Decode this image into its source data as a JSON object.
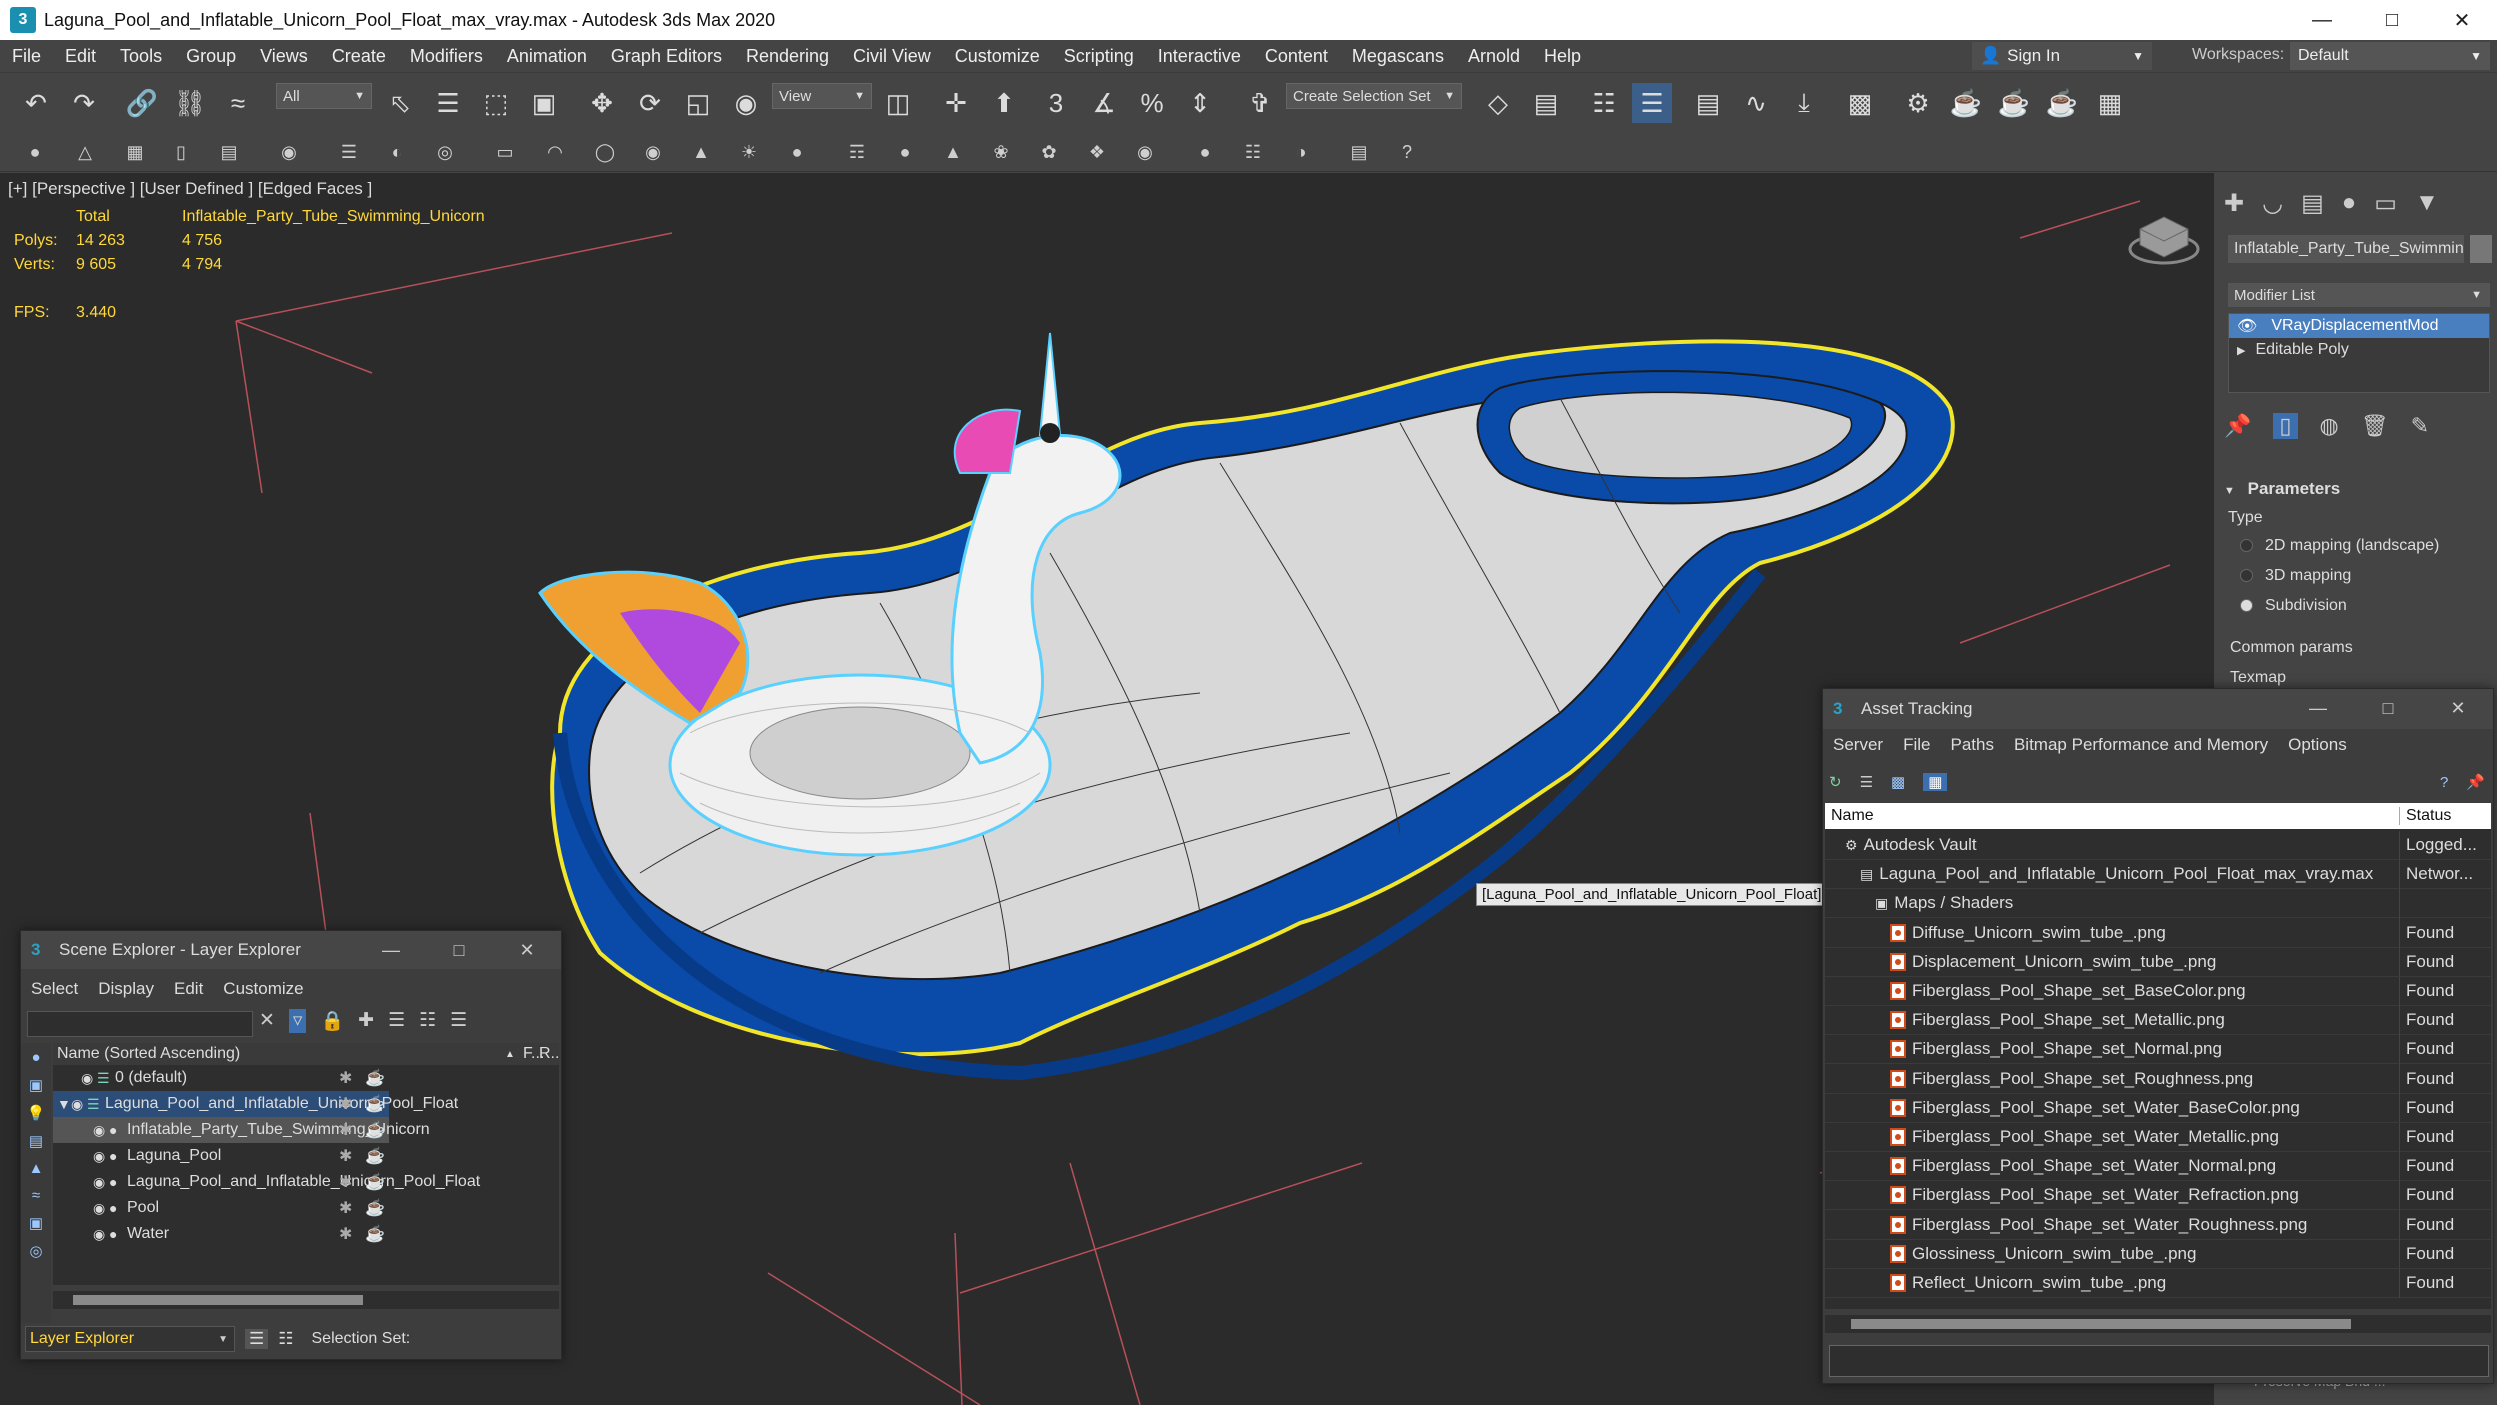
{
  "window": {
    "title": "Laguna_Pool_and_Inflatable_Unicorn_Pool_Float_max_vray.max - Autodesk 3ds Max 2020",
    "app_icon": "3"
  },
  "menu": [
    "File",
    "Edit",
    "Tools",
    "Group",
    "Views",
    "Create",
    "Modifiers",
    "Animation",
    "Graph Editors",
    "Rendering",
    "Civil View",
    "Customize",
    "Scripting",
    "Interactive",
    "Content",
    "Megascans",
    "Arnold",
    "Help"
  ],
  "account": {
    "sign_in": "Sign In",
    "workspaces_label": "Workspaces:",
    "workspace_value": "Default"
  },
  "toolbar": {
    "filter_value": "All",
    "refcoord_value": "View",
    "selection_set_placeholder": "Create Selection Set"
  },
  "viewport": {
    "label": "[+] [Perspective ] [User Defined ] [Edged Faces ]",
    "stats": {
      "total_label": "Total",
      "object_label": "Inflatable_Party_Tube_Swimming_Unicorn",
      "polys_label": "Polys:",
      "polys_total": "14 263",
      "polys_obj": "4 756",
      "verts_label": "Verts:",
      "verts_total": "9 605",
      "verts_obj": "4 794",
      "fps_label": "FPS:",
      "fps_value": "3.440"
    },
    "tooltip": "[Laguna_Pool_and_Inflatable_Unicorn_Pool_Float] Pool",
    "colors": {
      "pool_blue": "#0a4aa8",
      "selection_outline": "#f2e62a",
      "grid_red": "#b8505a"
    }
  },
  "command_panel": {
    "object_name": "Inflatable_Party_Tube_Swimming_Unicorn",
    "modifier_list": "Modifier List",
    "stack": [
      "VRayDisplacementMod",
      "Editable Poly"
    ],
    "parameters_header": "Parameters",
    "type_label": "Type",
    "type_options": [
      "2D mapping (landscape)",
      "3D mapping",
      "Subdivision"
    ],
    "type_selected": "Subdivision",
    "common_params": "Common params",
    "texmap": "Texmap",
    "preserve": "Preserve Map Bnd ..."
  },
  "scene_explorer": {
    "title": "Scene Explorer - Layer Explorer",
    "menu": [
      "Select",
      "Display",
      "Edit",
      "Customize"
    ],
    "column_name": "Name (Sorted Ascending)",
    "column_f": "F...",
    "column_r": "R...",
    "rows": [
      {
        "label": "0 (default)",
        "indent": 1
      },
      {
        "label": "Laguna_Pool_and_Inflatable_Unicorn_Pool_Float",
        "indent": 0
      },
      {
        "label": "Inflatable_Party_Tube_Swimming_Unicorn",
        "indent": 2
      },
      {
        "label": "Laguna_Pool",
        "indent": 2
      },
      {
        "label": "Laguna_Pool_and_Inflatable_Unicorn_Pool_Float",
        "indent": 2
      },
      {
        "label": "Pool",
        "indent": 2
      },
      {
        "label": "Water",
        "indent": 2
      }
    ],
    "footer_mode": "Layer Explorer",
    "footer_selection": "Selection Set:"
  },
  "asset_tracking": {
    "title": "Asset Tracking",
    "menu": [
      "Server",
      "File",
      "Paths",
      "Bitmap Performance and Memory",
      "Options"
    ],
    "col_name": "Name",
    "col_status": "Status",
    "rows": [
      {
        "name": "Autodesk Vault",
        "status": "Logged...",
        "indent": 0,
        "icon": "vault-icon"
      },
      {
        "name": "Laguna_Pool_and_Inflatable_Unicorn_Pool_Float_max_vray.max",
        "status": "Networ...",
        "indent": 1,
        "icon": "max-file-icon"
      },
      {
        "name": "Maps / Shaders",
        "status": "",
        "indent": 2,
        "icon": "maps-icon"
      },
      {
        "name": "Diffuse_Unicorn_swim_tube_.png",
        "status": "Found",
        "indent": 3,
        "icon": "image-file-icon"
      },
      {
        "name": "Displacement_Unicorn_swim_tube_.png",
        "status": "Found",
        "indent": 3,
        "icon": "image-file-icon"
      },
      {
        "name": "Fiberglass_Pool_Shape_set_BaseColor.png",
        "status": "Found",
        "indent": 3,
        "icon": "image-file-icon"
      },
      {
        "name": "Fiberglass_Pool_Shape_set_Metallic.png",
        "status": "Found",
        "indent": 3,
        "icon": "image-file-icon"
      },
      {
        "name": "Fiberglass_Pool_Shape_set_Normal.png",
        "status": "Found",
        "indent": 3,
        "icon": "image-file-icon"
      },
      {
        "name": "Fiberglass_Pool_Shape_set_Roughness.png",
        "status": "Found",
        "indent": 3,
        "icon": "image-file-icon"
      },
      {
        "name": "Fiberglass_Pool_Shape_set_Water_BaseColor.png",
        "status": "Found",
        "indent": 3,
        "icon": "image-file-icon"
      },
      {
        "name": "Fiberglass_Pool_Shape_set_Water_Metallic.png",
        "status": "Found",
        "indent": 3,
        "icon": "image-file-icon"
      },
      {
        "name": "Fiberglass_Pool_Shape_set_Water_Normal.png",
        "status": "Found",
        "indent": 3,
        "icon": "image-file-icon"
      },
      {
        "name": "Fiberglass_Pool_Shape_set_Water_Refraction.png",
        "status": "Found",
        "indent": 3,
        "icon": "image-file-icon"
      },
      {
        "name": "Fiberglass_Pool_Shape_set_Water_Roughness.png",
        "status": "Found",
        "indent": 3,
        "icon": "image-file-icon"
      },
      {
        "name": "Glossiness_Unicorn_swim_tube_.png",
        "status": "Found",
        "indent": 3,
        "icon": "image-file-icon"
      },
      {
        "name": "Reflect_Unicorn_swim_tube_.png",
        "status": "Found",
        "indent": 3,
        "icon": "image-file-icon"
      }
    ]
  }
}
